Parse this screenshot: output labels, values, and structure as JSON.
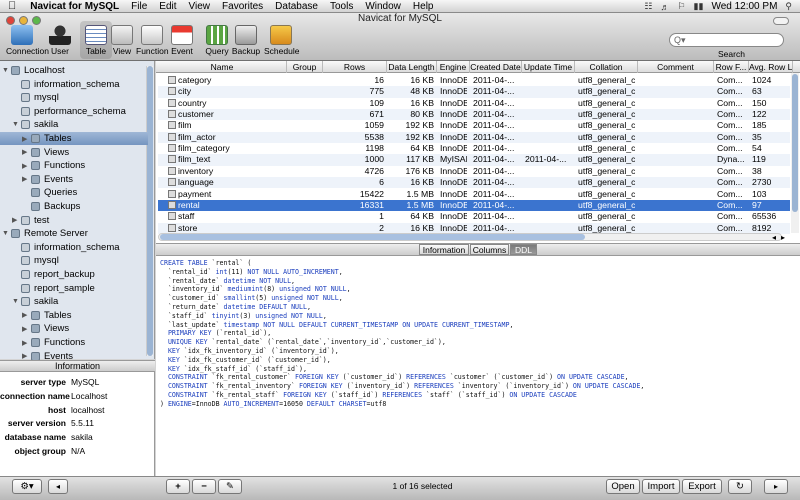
{
  "menubar": {
    "app_name": "Navicat for MySQL",
    "menus": [
      "File",
      "Edit",
      "View",
      "Favorites",
      "Database",
      "Tools",
      "Window",
      "Help"
    ],
    "clock": "Wed 12:00 PM"
  },
  "window": {
    "title": "Navicat for MySQL"
  },
  "toolbar": {
    "buttons": [
      {
        "label": "Connection",
        "icon": "connection-icon"
      },
      {
        "label": "User",
        "icon": "user-icon"
      },
      {
        "label": "Table",
        "icon": "table-icon"
      },
      {
        "label": "View",
        "icon": "view-icon"
      },
      {
        "label": "Function",
        "icon": "function-icon"
      },
      {
        "label": "Event",
        "icon": "event-icon"
      },
      {
        "label": "Query",
        "icon": "query-icon"
      },
      {
        "label": "Backup",
        "icon": "backup-icon"
      },
      {
        "label": "Schedule",
        "icon": "schedule-icon"
      }
    ],
    "search_label": "Search",
    "search_placeholder": "Q▾"
  },
  "sidebar": {
    "items": [
      {
        "label": "Localhost",
        "level": 0
      },
      {
        "label": "information_schema",
        "level": 1
      },
      {
        "label": "mysql",
        "level": 1
      },
      {
        "label": "performance_schema",
        "level": 1
      },
      {
        "label": "sakila",
        "level": 1
      },
      {
        "label": "Tables",
        "level": 2
      },
      {
        "label": "Views",
        "level": 2
      },
      {
        "label": "Functions",
        "level": 2
      },
      {
        "label": "Events",
        "level": 2
      },
      {
        "label": "Queries",
        "level": 2
      },
      {
        "label": "Backups",
        "level": 2
      },
      {
        "label": "test",
        "level": 1
      },
      {
        "label": "Remote Server",
        "level": 0
      },
      {
        "label": "information_schema",
        "level": 1
      },
      {
        "label": "mysql",
        "level": 1
      },
      {
        "label": "report_backup",
        "level": 1
      },
      {
        "label": "report_sample",
        "level": 1
      },
      {
        "label": "sakila",
        "level": 1
      },
      {
        "label": "Tables",
        "level": 2
      },
      {
        "label": "Views",
        "level": 2
      },
      {
        "label": "Functions",
        "level": 2
      },
      {
        "label": "Events",
        "level": 2
      }
    ],
    "selected": "Tables"
  },
  "info": {
    "header": "Information",
    "rows": [
      {
        "key": "server type",
        "value": "MySQL"
      },
      {
        "key": "connection name",
        "value": "Localhost"
      },
      {
        "key": "host",
        "value": "localhost"
      },
      {
        "key": "server version",
        "value": "5.5.11"
      },
      {
        "key": "database name",
        "value": "sakila"
      },
      {
        "key": "object group",
        "value": "N/A"
      }
    ]
  },
  "table": {
    "columns": [
      "Name",
      "Group",
      "Rows",
      "Data Length",
      "Engine",
      "Created Date",
      "Update Time",
      "Collation",
      "Comment",
      "Row F...",
      "Avg. Row L..."
    ],
    "rows": [
      [
        "category",
        "",
        "16",
        "16 KB",
        "InnoDB",
        "2011-04-...",
        "",
        "utf8_general_ci",
        "",
        "Com...",
        "1024"
      ],
      [
        "city",
        "",
        "775",
        "48 KB",
        "InnoDB",
        "2011-04-...",
        "",
        "utf8_general_ci",
        "",
        "Com...",
        "63"
      ],
      [
        "country",
        "",
        "109",
        "16 KB",
        "InnoDB",
        "2011-04-...",
        "",
        "utf8_general_ci",
        "",
        "Com...",
        "150"
      ],
      [
        "customer",
        "",
        "671",
        "80 KB",
        "InnoDB",
        "2011-04-...",
        "",
        "utf8_general_ci",
        "",
        "Com...",
        "122"
      ],
      [
        "film",
        "",
        "1059",
        "192 KB",
        "InnoDB",
        "2011-04-...",
        "",
        "utf8_general_ci",
        "",
        "Com...",
        "185"
      ],
      [
        "film_actor",
        "",
        "5538",
        "192 KB",
        "InnoDB",
        "2011-04-...",
        "",
        "utf8_general_ci",
        "",
        "Com...",
        "35"
      ],
      [
        "film_category",
        "",
        "1198",
        "64 KB",
        "InnoDB",
        "2011-04-...",
        "",
        "utf8_general_ci",
        "",
        "Com...",
        "54"
      ],
      [
        "film_text",
        "",
        "1000",
        "117 KB",
        "MyISAM",
        "2011-04-...",
        "2011-04-...",
        "utf8_general_ci",
        "",
        "Dyna...",
        "119"
      ],
      [
        "inventory",
        "",
        "4726",
        "176 KB",
        "InnoDB",
        "2011-04-...",
        "",
        "utf8_general_ci",
        "",
        "Com...",
        "38"
      ],
      [
        "language",
        "",
        "6",
        "16 KB",
        "InnoDB",
        "2011-04-...",
        "",
        "utf8_general_ci",
        "",
        "Com...",
        "2730"
      ],
      [
        "payment",
        "",
        "15422",
        "1.5 MB",
        "InnoDB",
        "2011-04-...",
        "",
        "utf8_general_ci",
        "",
        "Com...",
        "103"
      ],
      [
        "rental",
        "",
        "16331",
        "1.5 MB",
        "InnoDB",
        "2011-04-...",
        "",
        "utf8_general_ci",
        "",
        "Com...",
        "97"
      ],
      [
        "staff",
        "",
        "1",
        "64 KB",
        "InnoDB",
        "2011-04-...",
        "",
        "utf8_general_ci",
        "",
        "Com...",
        "65536"
      ],
      [
        "store",
        "",
        "2",
        "16 KB",
        "InnoDB",
        "2011-04-...",
        "",
        "utf8_general_ci",
        "",
        "Com...",
        "8192"
      ]
    ],
    "selected_row": 11
  },
  "tabs": [
    "Information",
    "Columns",
    "DDL"
  ],
  "active_tab": "DDL",
  "ddl": [
    "CREATE TABLE `rental` (",
    "  `rental_id` int(11) NOT NULL AUTO_INCREMENT,",
    "  `rental_date` datetime NOT NULL,",
    "  `inventory_id` mediumint(8) unsigned NOT NULL,",
    "  `customer_id` smallint(5) unsigned NOT NULL,",
    "  `return_date` datetime DEFAULT NULL,",
    "  `staff_id` tinyint(3) unsigned NOT NULL,",
    "  `last_update` timestamp NOT NULL DEFAULT CURRENT_TIMESTAMP ON UPDATE CURRENT_TIMESTAMP,",
    "  PRIMARY KEY (`rental_id`),",
    "  UNIQUE KEY `rental_date` (`rental_date`,`inventory_id`,`customer_id`),",
    "  KEY `idx_fk_inventory_id` (`inventory_id`),",
    "  KEY `idx_fk_customer_id` (`customer_id`),",
    "  KEY `idx_fk_staff_id` (`staff_id`),",
    "  CONSTRAINT `fk_rental_customer` FOREIGN KEY (`customer_id`) REFERENCES `customer` (`customer_id`) ON UPDATE CASCADE,",
    "  CONSTRAINT `fk_rental_inventory` FOREIGN KEY (`inventory_id`) REFERENCES `inventory` (`inventory_id`) ON UPDATE CASCADE,",
    "  CONSTRAINT `fk_rental_staff` FOREIGN KEY (`staff_id`) REFERENCES `staff` (`staff_id`) ON UPDATE CASCADE",
    ") ENGINE=InnoDB AUTO_INCREMENT=16050 DEFAULT CHARSET=utf8"
  ],
  "bottombar": {
    "status": "1 of 16 selected",
    "open_label": "Open",
    "import_label": "Import",
    "export_label": "Export",
    "gear_symbol": "⚙▾",
    "add_symbol": "+",
    "remove_symbol": "−",
    "edit_symbol": "✎",
    "refresh_symbol": "↻",
    "left_symbol": "◂",
    "right_symbol": "▸"
  },
  "colors": {
    "selection": "#3b74cf",
    "sidebar": "#e0e6ee",
    "keyword": "#1a3dbd"
  }
}
